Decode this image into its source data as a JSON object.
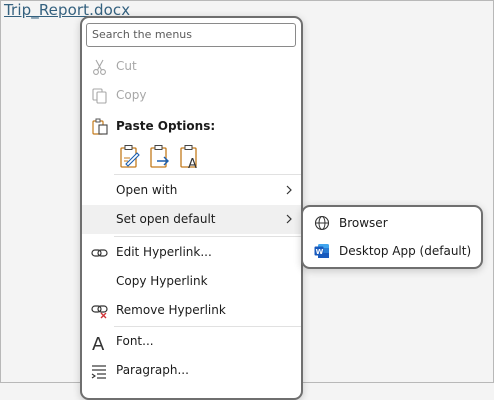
{
  "document": {
    "link_text": "Trip_Report.docx"
  },
  "menu": {
    "search_placeholder": "Search the menus",
    "cut": "Cut",
    "copy": "Copy",
    "paste_options": "Paste Options:",
    "open_with": "Open with",
    "set_open_default": "Set open default",
    "edit_hyperlink": "Edit Hyperlink...",
    "copy_hyperlink": "Copy Hyperlink",
    "remove_hyperlink": "Remove Hyperlink",
    "font": "Font...",
    "paragraph": "Paragraph..."
  },
  "submenu": {
    "browser": "Browser",
    "desktop_app": "Desktop App (default)"
  },
  "colors": {
    "link": "#34617f",
    "accent_blue": "#1b5fb0",
    "paste_orange": "#c47b1c",
    "word_blue": "#185abd",
    "remove_red": "#d13438"
  },
  "icons": [
    "scissors-icon",
    "copy-icon",
    "clipboard-icon",
    "paste-keep-formatting-icon",
    "paste-merge-icon",
    "paste-text-only-icon",
    "chevron-right-icon",
    "link-icon",
    "remove-link-icon",
    "font-icon",
    "paragraph-icon",
    "globe-icon",
    "word-app-icon"
  ]
}
